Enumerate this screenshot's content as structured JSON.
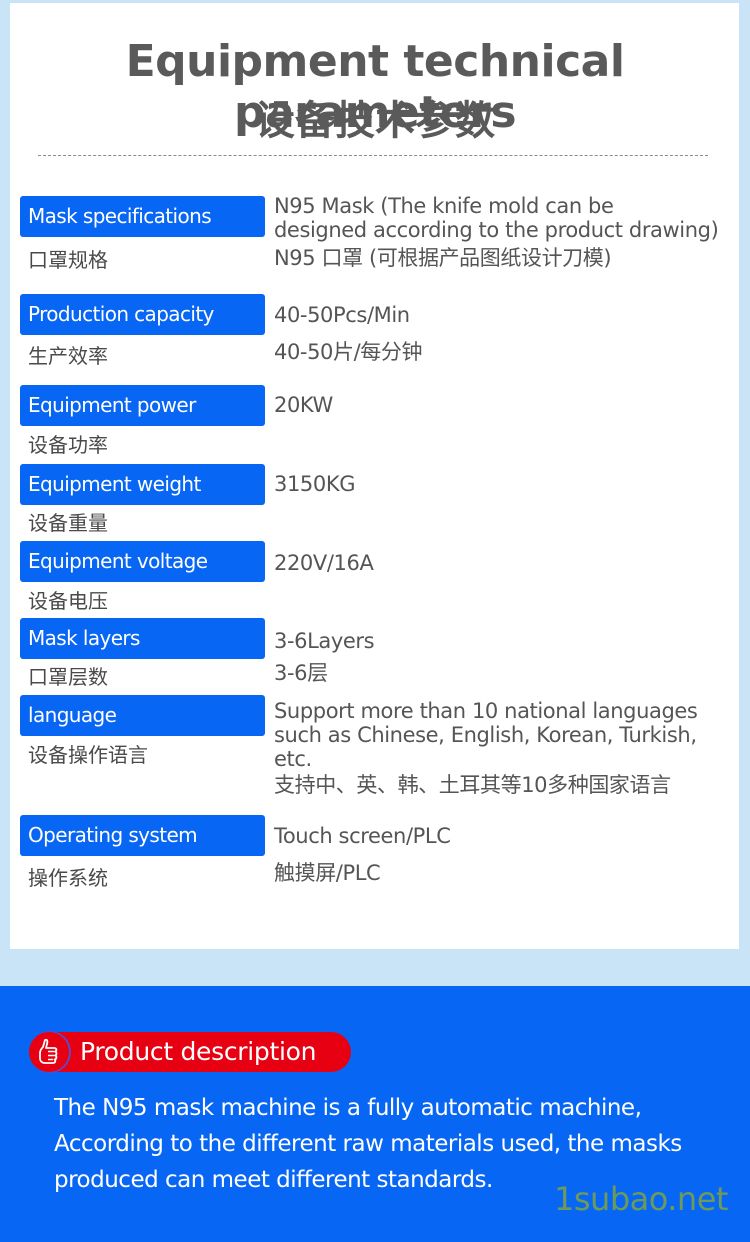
{
  "header": {
    "title_en": "Equipment technical parameters",
    "title_zh": "设备技术参数"
  },
  "params": [
    {
      "label_en": "Mask specifications",
      "label_zh": "口罩规格",
      "value_lines": [
        "N95 Mask (The knife mold can be",
        "designed according to the product drawing)",
        "N95 口罩 (可根据产品图纸设计刀模)"
      ]
    },
    {
      "label_en": "Production capacity",
      "label_zh": "生产效率",
      "value_lines": [
        "40-50Pcs/Min",
        "40-50片/每分钟"
      ]
    },
    {
      "label_en": "Equipment power",
      "label_zh": "设备功率",
      "value_lines": [
        "20KW"
      ]
    },
    {
      "label_en": "Equipment weight",
      "label_zh": "设备重量",
      "value_lines": [
        "3150KG"
      ]
    },
    {
      "label_en": "Equipment voltage",
      "label_zh": "设备电压",
      "value_lines": [
        "220V/16A"
      ]
    },
    {
      "label_en": "Mask layers",
      "label_zh": "口罩层数",
      "value_lines": [
        "3-6Layers",
        "3-6层"
      ]
    },
    {
      "label_en": "language",
      "label_zh": "设备操作语言",
      "value_lines": [
        "Support more than 10 national languages",
        "such as Chinese, English, Korean, Turkish,",
        "etc.",
        "支持中、英、韩、土耳其等10多种国家语言"
      ]
    },
    {
      "label_en": "Operating system",
      "label_zh": "操作系统",
      "value_lines": [
        "Touch screen/PLC",
        "触摸屏/PLC"
      ]
    }
  ],
  "product_description": {
    "heading": "Product description",
    "icon": "thumbs-up-icon",
    "lines": [
      "The N95 mask machine is a fully automatic machine,",
      "According to the different raw materials used, the masks",
      "produced can meet different standards."
    ]
  },
  "watermark": "1subao.net",
  "colors": {
    "accent_blue": "#0866f5",
    "pill_red": "#e60012",
    "page_bg": "#c9e4f6",
    "text_gray": "#555555"
  }
}
